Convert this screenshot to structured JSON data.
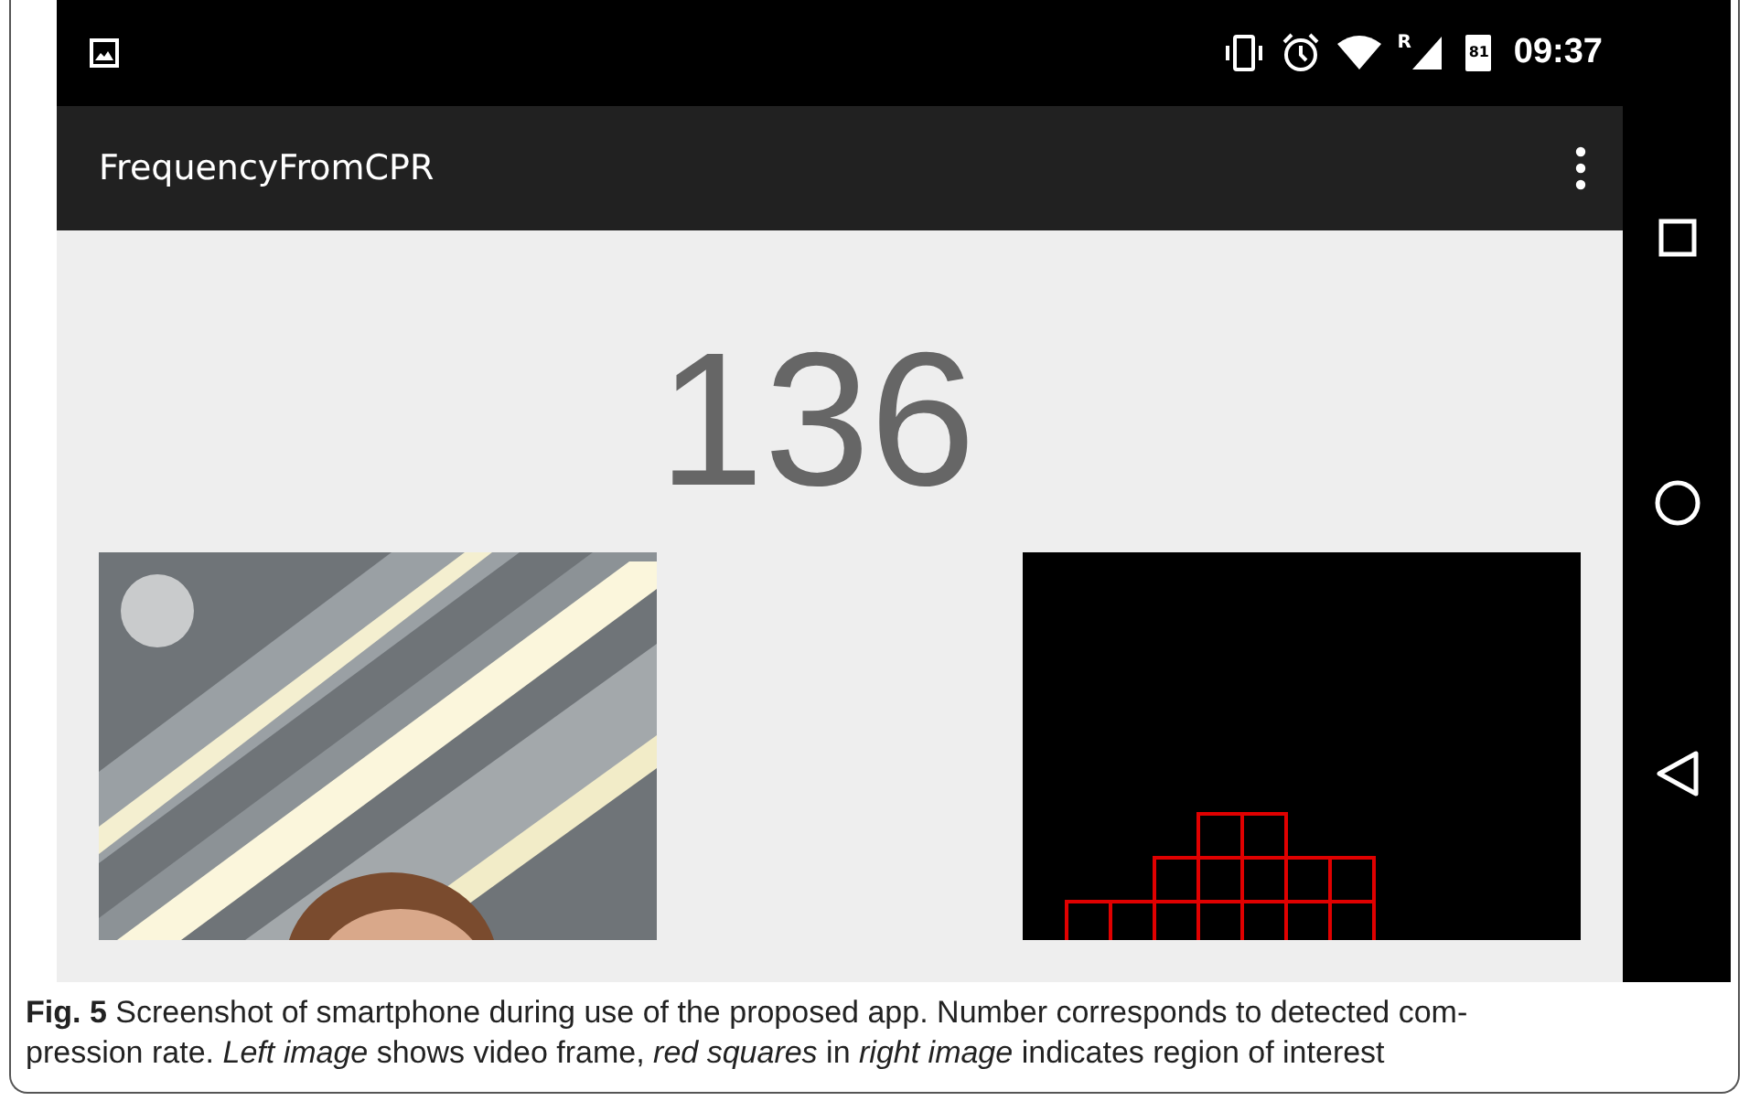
{
  "status_bar": {
    "roaming": "R",
    "battery": "81",
    "time": "09:37"
  },
  "app_bar": {
    "title": "FrequencyFromCPR"
  },
  "content": {
    "rate": "136"
  },
  "caption": {
    "lines": [
      "**Fig. 5**  Screenshot of smartphone during use of the proposed app. Number corresponds to detected com-",
      "pression rate. *Left image* shows video frame, *red squares* in *right image* indicates region of interest"
    ]
  }
}
